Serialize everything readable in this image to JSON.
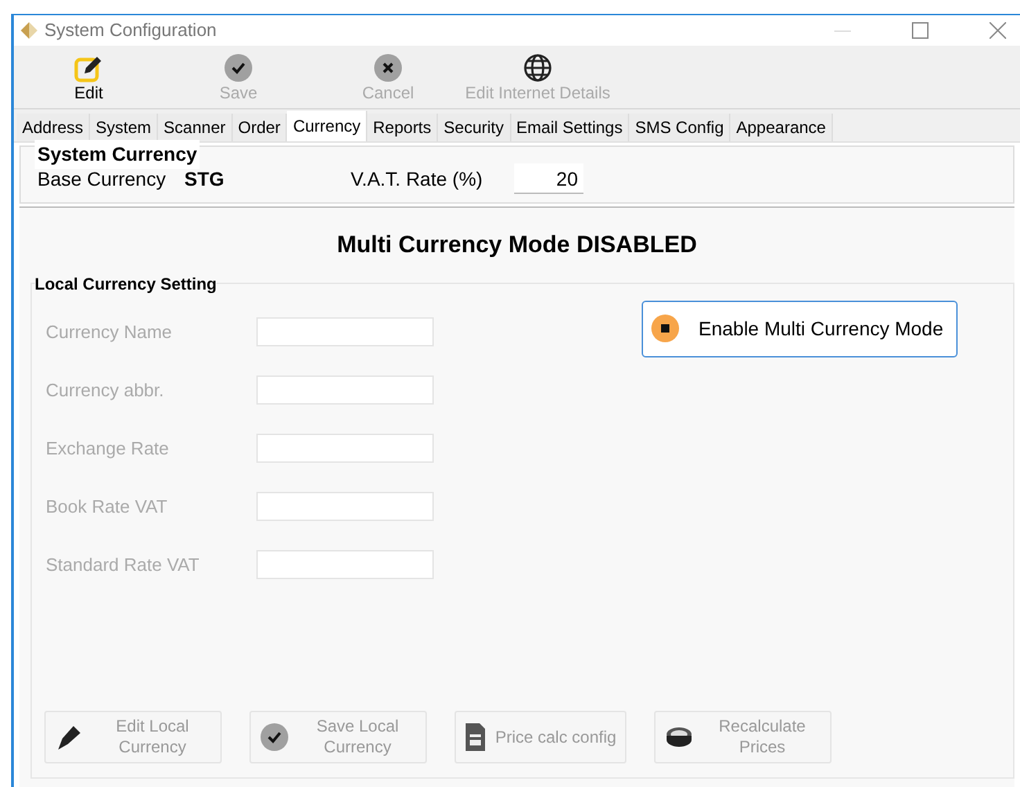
{
  "window": {
    "title": "System Configuration"
  },
  "toolbar": [
    {
      "label": "Edit",
      "kind": "edit",
      "disabled": false
    },
    {
      "label": "Save",
      "kind": "check",
      "disabled": true
    },
    {
      "label": "Cancel",
      "kind": "cross",
      "disabled": true
    },
    {
      "label": "Edit Internet Details",
      "kind": "globe",
      "disabled": true
    }
  ],
  "tabs": [
    {
      "label": "Address",
      "selected": false
    },
    {
      "label": "System",
      "selected": false
    },
    {
      "label": "Scanner",
      "selected": false
    },
    {
      "label": "Order",
      "selected": false
    },
    {
      "label": "Currency",
      "selected": true
    },
    {
      "label": "Reports",
      "selected": false
    },
    {
      "label": "Security",
      "selected": false
    },
    {
      "label": "Email Settings",
      "selected": false
    },
    {
      "label": "SMS Config",
      "selected": false
    },
    {
      "label": "Appearance",
      "selected": false
    }
  ],
  "system_currency": {
    "title": "System Currency",
    "base_currency_label": "Base Currency",
    "base_currency_value": "STG",
    "vat_label": "V.A.T. Rate (%)",
    "vat_value": "20"
  },
  "mode_heading": "Multi Currency Mode DISABLED",
  "local_currency": {
    "title": "Local Currency Setting",
    "fields": [
      {
        "label": "Currency Name",
        "disabled": true
      },
      {
        "label": "Currency abbr.",
        "disabled": true
      },
      {
        "label": "Exchange Rate",
        "disabled": true
      },
      {
        "label": "Book Rate VAT",
        "disabled": true
      },
      {
        "label": "Standard Rate VAT",
        "disabled": true
      }
    ],
    "enable_button": {
      "label": "Enable Multi Currency Mode"
    },
    "buttons": [
      {
        "label": "Edit Local Currency",
        "kind": "pen",
        "disabled": true
      },
      {
        "label": "Save Local Currency",
        "kind": "check",
        "disabled": true
      },
      {
        "label": "Price calc config",
        "kind": "document",
        "disabled": true
      },
      {
        "label": "Recalculate Prices",
        "kind": "coins",
        "disabled": true
      }
    ]
  }
}
